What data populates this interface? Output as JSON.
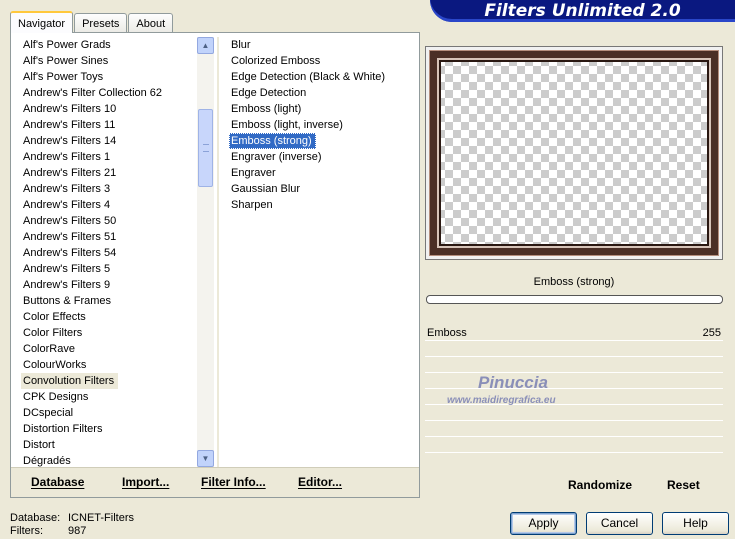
{
  "tabs": [
    "Navigator",
    "Presets",
    "About"
  ],
  "banner_title": "Filters Unlimited 2.0",
  "categories": [
    "Alf's Power Grads",
    "Alf's Power Sines",
    "Alf's Power Toys",
    "Andrew's Filter Collection 62",
    "Andrew's Filters 10",
    "Andrew's Filters 11",
    "Andrew's Filters 14",
    "Andrew's Filters 1",
    "Andrew's Filters 21",
    "Andrew's Filters 3",
    "Andrew's Filters 4",
    "Andrew's Filters 50",
    "Andrew's Filters 51",
    "Andrew's Filters 54",
    "Andrew's Filters 5",
    "Andrew's Filters 9",
    "Buttons & Frames",
    "Color Effects",
    "Color Filters",
    "ColorRave",
    "ColourWorks",
    "Convolution Filters",
    "CPK Designs",
    "DCspecial",
    "Distortion Filters",
    "Distort",
    "Dégradés"
  ],
  "selected_category": "Convolution Filters",
  "filters": [
    "Blur",
    "Colorized Emboss",
    "Edge Detection (Black & White)",
    "Edge Detection",
    "Emboss (light)",
    "Emboss (light, inverse)",
    "Emboss (strong)",
    "Engraver (inverse)",
    "Engraver",
    "Gaussian Blur",
    "Sharpen"
  ],
  "selected_filter": "Emboss (strong)",
  "panel_buttons": {
    "database": "Database",
    "import": "Import...",
    "filter_info": "Filter Info...",
    "editor": "Editor..."
  },
  "preview_filter_name": "Emboss (strong)",
  "params": [
    {
      "label": "Emboss",
      "value": "255"
    }
  ],
  "watermark": {
    "name": "Pinuccia",
    "url": "www.maidiregrafica.eu"
  },
  "right_buttons": {
    "randomize": "Randomize",
    "reset": "Reset"
  },
  "status": {
    "database_label": "Database:",
    "database_value": "ICNET-Filters",
    "filters_label": "Filters:",
    "filters_value": "987"
  },
  "dialog_buttons": {
    "apply": "Apply",
    "cancel": "Cancel",
    "help": "Help"
  },
  "colors": {
    "banner": "#0a1880",
    "selection": "#316ac5",
    "dialog_bg": "#ece9d8"
  }
}
